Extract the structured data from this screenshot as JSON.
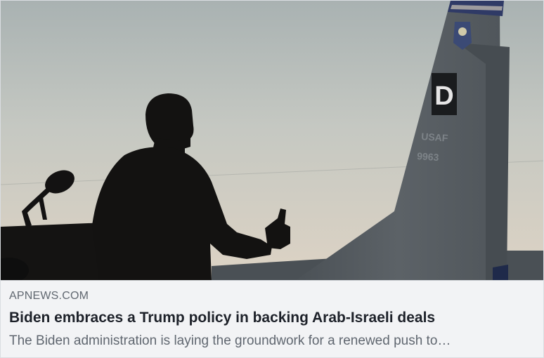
{
  "link_preview": {
    "domain": "APNEWS.COM",
    "headline": "Biden embraces a Trump policy in backing Arab-Israeli deals",
    "description": "The Biden administration is laying the groundwork for a renewed push to…",
    "image": {
      "tail_letter": "D",
      "tail_text_1": "USAF",
      "tail_text_2": "9963"
    }
  },
  "colors": {
    "meta_background": "#f2f3f5",
    "domain_text": "#606770",
    "headline_text": "#1d2129",
    "description_text": "#606770",
    "sky_top": "#a8b2b3",
    "sky_bottom": "#d9d1c4",
    "aircraft_tail": "#555b60"
  }
}
